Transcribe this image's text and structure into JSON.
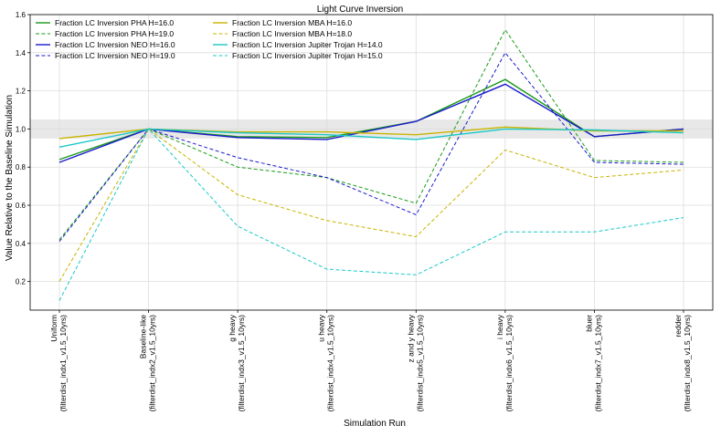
{
  "chart_data": {
    "type": "line",
    "title": "Light Curve Inversion",
    "xlabel": "Simulation Run",
    "ylabel": "Value Relative to the Baseline Simulation",
    "ylim": [
      0.05,
      1.6
    ],
    "yticks": [
      0.2,
      0.4,
      0.6,
      0.8,
      1.0,
      1.2,
      1.4,
      1.6
    ],
    "grid": true,
    "legend_position": "top-left",
    "shaded_band": {
      "y0": 0.95,
      "y1": 1.05,
      "color": "#e8e8e8"
    },
    "categories": [
      {
        "line1": "Uniform",
        "line2": "(filterdist_indx1_v1.5_10yrs)"
      },
      {
        "line1": "Baseline-like",
        "line2": "(filterdist_indx2_v1.5_10yrs)"
      },
      {
        "line1": "g heavy",
        "line2": "(filterdist_indx3_v1.5_10yrs)"
      },
      {
        "line1": "u heavy",
        "line2": "(filterdist_indx4_v1.5_10yrs)"
      },
      {
        "line1": "z and y heavy",
        "line2": "(filterdist_indx5_v1.5_10yrs)"
      },
      {
        "line1": "i heavy",
        "line2": "(filterdist_indx6_v1.5_10yrs)"
      },
      {
        "line1": "bluer",
        "line2": "(filterdist_indx7_v1.5_10yrs)"
      },
      {
        "line1": "redder",
        "line2": "(filterdist_indx8_v1.5_10yrs)"
      }
    ],
    "series": [
      {
        "name": "Fraction LC Inversion PHA H=16.0",
        "color": "#1a9a1a",
        "dash": "solid",
        "values": [
          0.84,
          1.0,
          0.96,
          0.955,
          1.04,
          1.26,
          0.96,
          1.0
        ]
      },
      {
        "name": "Fraction LC Inversion PHA H=19.0",
        "color": "#1a9a1a",
        "dash": "dashed",
        "values": [
          0.42,
          1.0,
          0.8,
          0.745,
          0.61,
          1.52,
          0.835,
          0.825
        ]
      },
      {
        "name": "Fraction LC Inversion NEO H=16.0",
        "color": "#1a1acc",
        "dash": "solid",
        "values": [
          0.825,
          1.0,
          0.955,
          0.945,
          1.04,
          1.235,
          0.96,
          1.0
        ]
      },
      {
        "name": "Fraction LC Inversion NEO H=19.0",
        "color": "#1a1acc",
        "dash": "dashed",
        "values": [
          0.41,
          1.0,
          0.85,
          0.745,
          0.55,
          1.4,
          0.825,
          0.815
        ]
      },
      {
        "name": "Fraction LC Inversion MBA H=16.0",
        "color": "#c8b400",
        "dash": "solid",
        "values": [
          0.95,
          1.0,
          0.985,
          0.985,
          0.97,
          1.01,
          0.99,
          0.99
        ]
      },
      {
        "name": "Fraction LC Inversion MBA H=18.0",
        "color": "#c8b400",
        "dash": "dashed",
        "values": [
          0.2,
          1.0,
          0.655,
          0.52,
          0.435,
          0.89,
          0.745,
          0.785
        ]
      },
      {
        "name": "Fraction LC Inversion Jupiter Trojan H=14.0",
        "color": "#1ac8c8",
        "dash": "solid",
        "values": [
          0.905,
          1.0,
          0.98,
          0.97,
          0.945,
          1.0,
          0.995,
          0.98
        ]
      },
      {
        "name": "Fraction LC Inversion Jupiter Trojan H=15.0",
        "color": "#1ac8c8",
        "dash": "dashed",
        "values": [
          0.1,
          1.0,
          0.49,
          0.265,
          0.235,
          0.46,
          0.46,
          0.535
        ]
      }
    ]
  }
}
